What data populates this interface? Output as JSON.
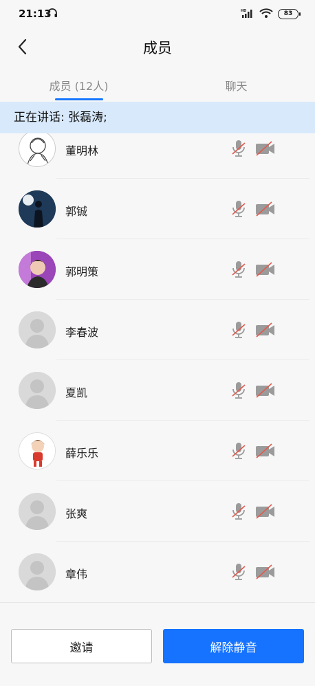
{
  "status": {
    "time": "21:13",
    "battery": "83",
    "network": "HD"
  },
  "header": {
    "title": "成员"
  },
  "tabs": [
    {
      "label": "成员 (12人)",
      "active": true
    },
    {
      "label": "聊天",
      "active": false
    }
  ],
  "banner": {
    "text": "正在讲话: 张磊涛;"
  },
  "members": [
    {
      "name": "董明林",
      "avatar": "sketch",
      "mic": "muted",
      "camera": "off"
    },
    {
      "name": "郭铖",
      "avatar": "photo-night",
      "mic": "muted",
      "camera": "off"
    },
    {
      "name": "郭明策",
      "avatar": "photo-purple",
      "mic": "muted",
      "camera": "off"
    },
    {
      "name": "李春波",
      "avatar": "default",
      "mic": "muted",
      "camera": "off"
    },
    {
      "name": "夏凯",
      "avatar": "default",
      "mic": "muted",
      "camera": "off"
    },
    {
      "name": "薛乐乐",
      "avatar": "cartoon",
      "mic": "muted",
      "camera": "off"
    },
    {
      "name": "张爽",
      "avatar": "default",
      "mic": "muted",
      "camera": "off"
    },
    {
      "name": "章伟",
      "avatar": "default",
      "mic": "muted",
      "camera": "off"
    }
  ],
  "buttons": {
    "invite": "邀请",
    "unmute": "解除静音"
  },
  "colors": {
    "accent": "#1673ff",
    "banner_bg": "#d8e9fb",
    "muted_slash": "#e05a4e",
    "icon_gray": "#9b9b9b"
  }
}
